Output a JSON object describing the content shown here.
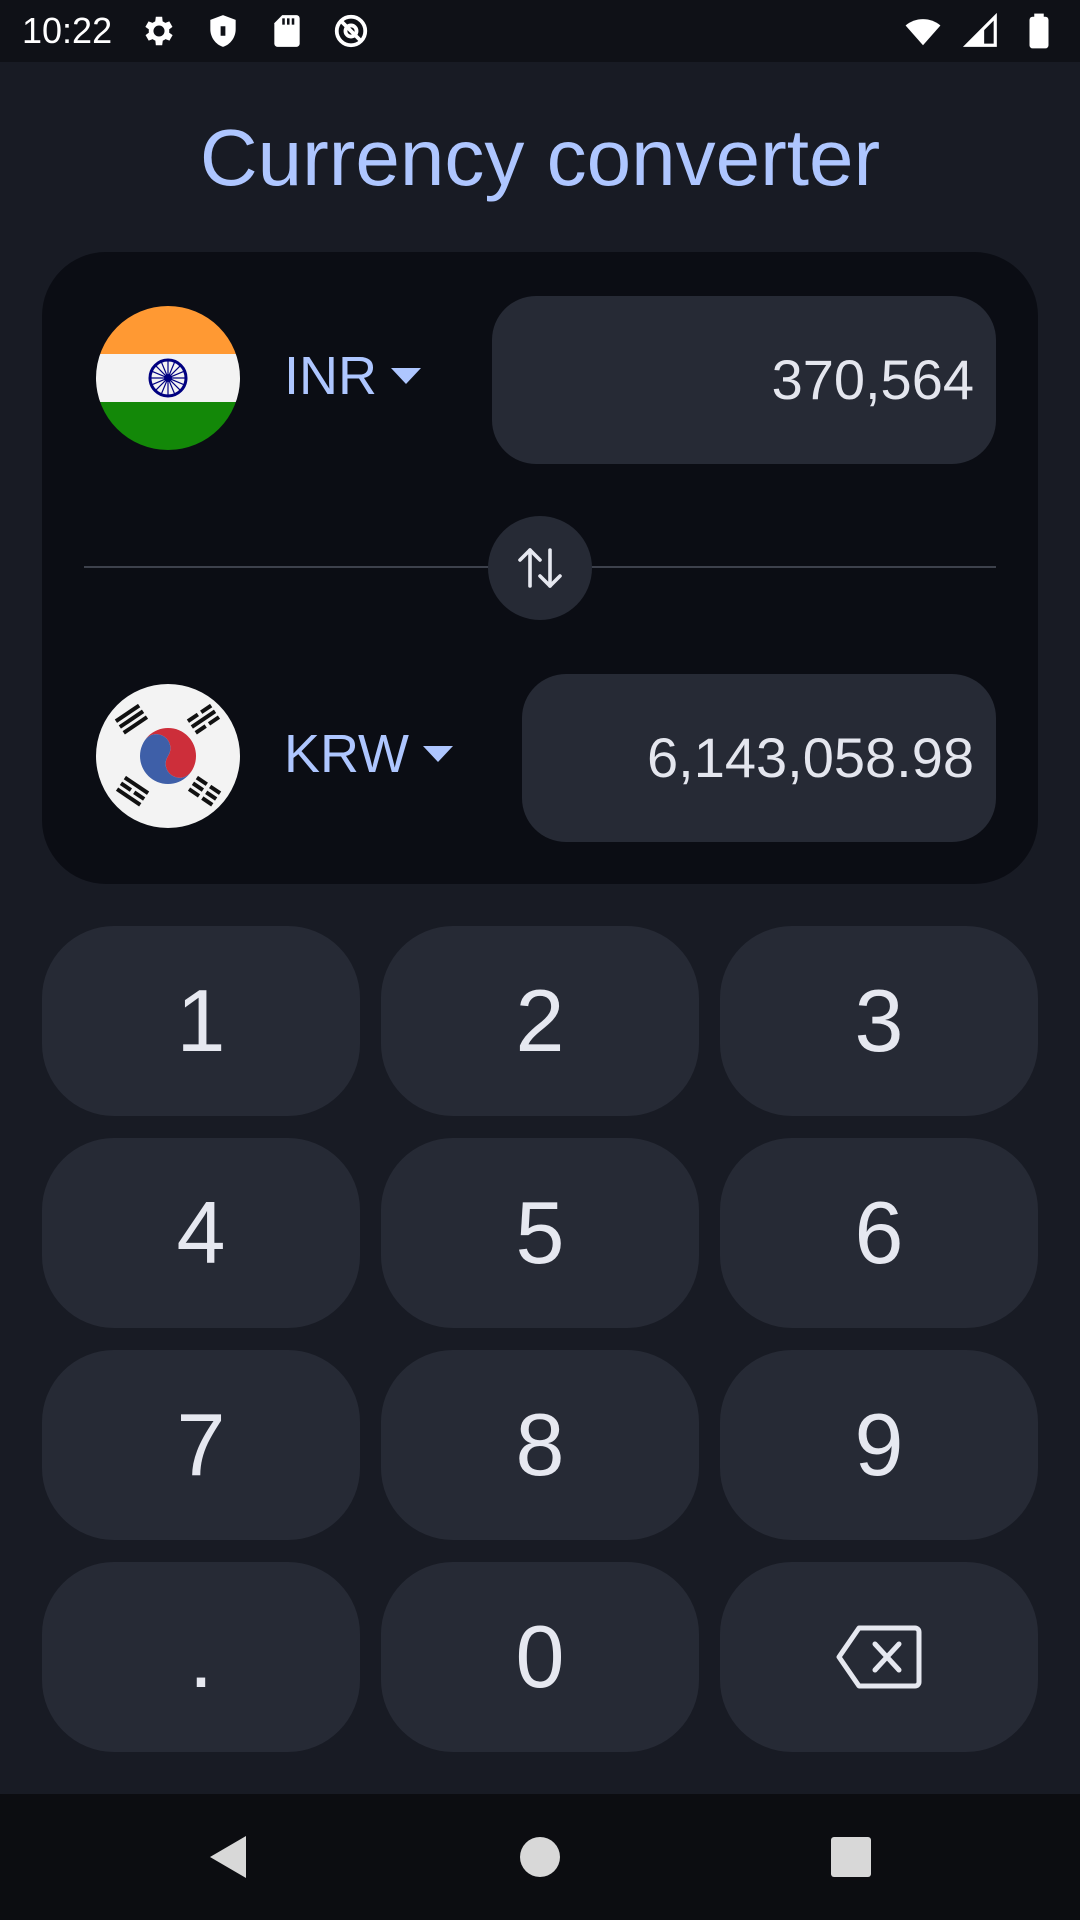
{
  "status_bar": {
    "time": "10:22",
    "left_icons": [
      "settings-icon",
      "shield-icon",
      "sd-card-icon",
      "at-sign-icon"
    ],
    "right_icons": [
      "wifi-icon",
      "signal-icon",
      "battery-icon"
    ]
  },
  "header": {
    "title": "Currency converter"
  },
  "converter": {
    "from": {
      "flag": "india-flag-icon",
      "currency": "INR",
      "amount": "370,564"
    },
    "to": {
      "flag": "south-korea-flag-icon",
      "currency": "KRW",
      "amount": "6,143,058.98"
    },
    "swap_icon": "swap-vertical-icon"
  },
  "keypad": {
    "keys": [
      "1",
      "2",
      "3",
      "4",
      "5",
      "6",
      "7",
      "8",
      "9",
      ".",
      "0"
    ],
    "backspace_icon": "backspace-icon"
  },
  "nav_bar": {
    "buttons": [
      "back-icon",
      "home-icon",
      "recents-icon"
    ]
  },
  "colors": {
    "background": "#181b24",
    "card": "#0b0d14",
    "surface": "#262a35",
    "accent": "#aec6ff",
    "text": "#e4e6ee"
  }
}
